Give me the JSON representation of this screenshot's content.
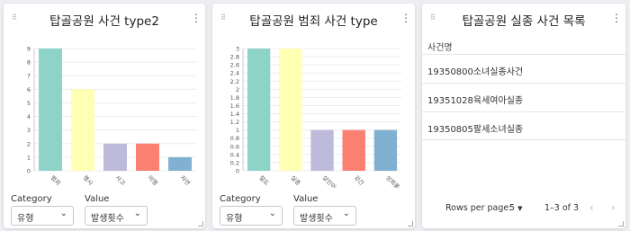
{
  "cards": [
    {
      "title": "탑골공원 사건 type2",
      "chart_data": {
        "type": "bar",
        "categories": [
          "범죄",
          "행사",
          "사고",
          "미행",
          "자연"
        ],
        "values": [
          9,
          6,
          2,
          2,
          1
        ],
        "colors": [
          "#8dd3c7",
          "#ffffb3",
          "#bebada",
          "#fb8072",
          "#80b1d3"
        ],
        "yticks": [
          "0",
          "1",
          "2",
          "3",
          "4",
          "5",
          "6",
          "7",
          "8",
          "9"
        ],
        "ylim": [
          0,
          9
        ],
        "grid": true
      },
      "controls": {
        "category_label": "Category",
        "category_value": "유형",
        "value_label": "Value",
        "value_value": "발생횟수"
      }
    },
    {
      "title": "탑골공원 범죄 사건 type",
      "chart_data": {
        "type": "bar",
        "categories": [
          "절도",
          "실종",
          "살인미수",
          "강간",
          "성희롱"
        ],
        "values": [
          3,
          3,
          1,
          1,
          1
        ],
        "colors": [
          "#8dd3c7",
          "#ffffb3",
          "#bebada",
          "#fb8072",
          "#80b1d3"
        ],
        "yticks": [
          "0",
          "0.2",
          "0.4",
          "0.6",
          "0.8",
          "1",
          "1.2",
          "1.4",
          "1.6",
          "1.8",
          "2",
          "2.2",
          "2.4",
          "2.6",
          "2.8",
          "3"
        ],
        "ylim": [
          0,
          3
        ],
        "grid": true
      },
      "controls": {
        "category_label": "Category",
        "category_value": "유형",
        "value_label": "Value",
        "value_value": "발생횟수"
      }
    }
  ],
  "list": {
    "title": "탑골공원 실종 사건 목록",
    "column": "사건명",
    "rows": [
      "19350800소녀실종사건",
      "19351028육세여아실종",
      "19350805팔세소녀실종"
    ],
    "rows_per_page_label": "Rows per page:",
    "rows_per_page_value": "5",
    "range": "1–3 of 3"
  },
  "icons": {
    "drag": "drag-handle-icon",
    "menu": "more-vert-icon",
    "chevron": "chevron-down-icon",
    "prev": "chevron-left-icon",
    "next": "chevron-right-icon"
  }
}
